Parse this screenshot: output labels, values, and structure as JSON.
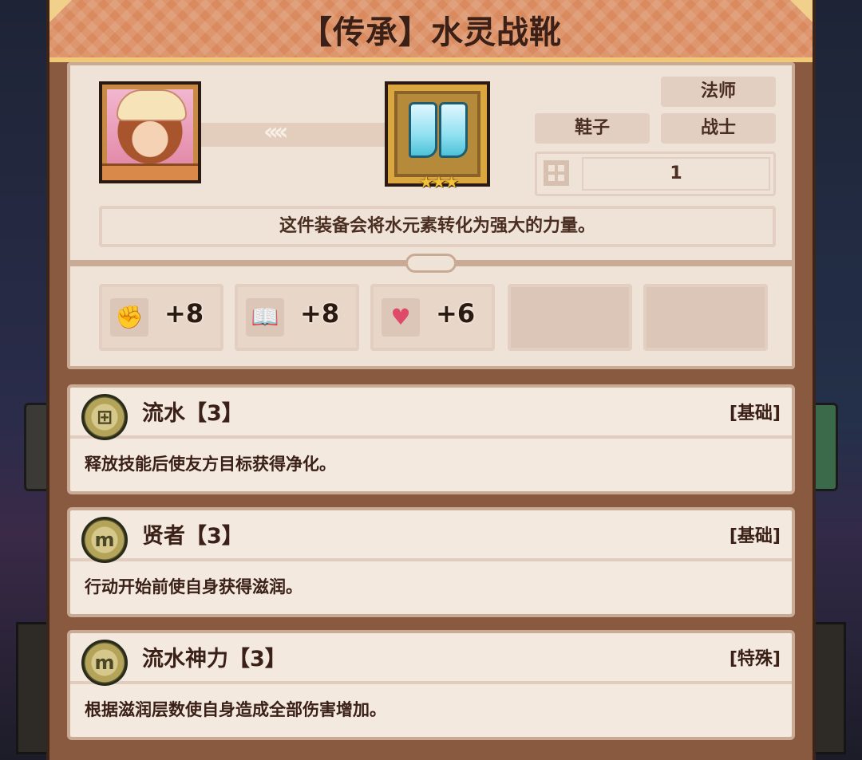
{
  "title": "【传承】水灵战靴",
  "item": {
    "icon": "water-boots-icon",
    "stars": "★★★",
    "tags": [
      "法师",
      "鞋子",
      "战士"
    ],
    "level": "1",
    "description": "这件装备会将水元素转化为强大的力量。"
  },
  "stats": [
    {
      "icon": "fist-icon",
      "glyph": "✊",
      "value": "+8"
    },
    {
      "icon": "book-icon",
      "glyph": "📖",
      "value": "+8"
    },
    {
      "icon": "heart-icon",
      "glyph": "♥",
      "value": "+6"
    }
  ],
  "skills": [
    {
      "name": "流水【3】",
      "type": "[基础]",
      "desc": "释放技能后使友方目标获得净化。",
      "glyph": "⊞",
      "icon": "water-rune-icon"
    },
    {
      "name": "贤者【3】",
      "type": "[基础]",
      "desc": "行动开始前使自身获得滋润。",
      "glyph": "m",
      "icon": "sage-rune-icon"
    },
    {
      "name": "流水神力【3】",
      "type": "[特殊]",
      "desc": "根据滋润层数使自身造成全部伤害增加。",
      "glyph": "m",
      "icon": "sage-rune-icon"
    }
  ],
  "colors": {
    "accent": "#d98a5e",
    "panel": "#efe2d6",
    "frame": "#8a5a40",
    "text": "#3a2016"
  }
}
